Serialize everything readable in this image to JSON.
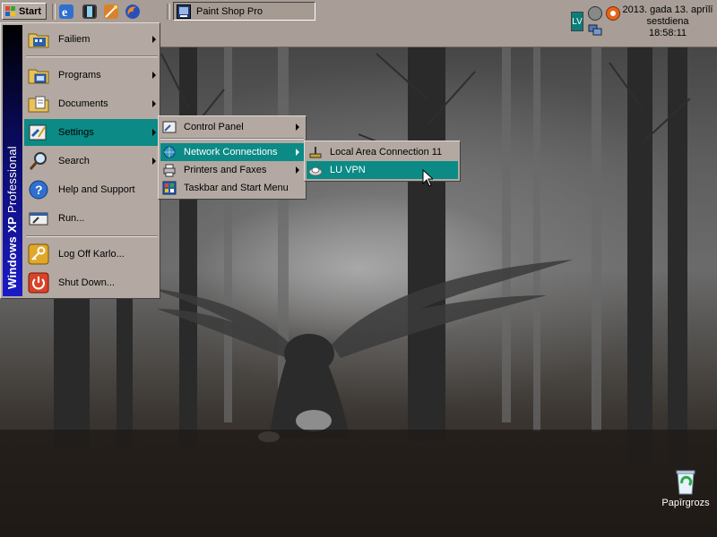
{
  "taskbar": {
    "start_label": "Start",
    "quick_launch": [
      "ie-icon",
      "media-icon",
      "wand-icon",
      "firefox-icon"
    ],
    "tasks": [
      {
        "label": "Paint Shop Pro",
        "icon": "paint-shop-pro-icon"
      }
    ],
    "tray": {
      "language": "LV",
      "clock_date": "2013. gada 13. aprīlī",
      "clock_day": "sestdiena",
      "clock_time": "18:58:11"
    }
  },
  "start_menu": {
    "banner_bold": "Windows XP",
    "banner_light": " Professional",
    "items": [
      {
        "label": "Failiem",
        "icon": "folder-icon",
        "submenu": true
      },
      {
        "label": "Programs",
        "icon": "programs-icon",
        "submenu": true
      },
      {
        "label": "Documents",
        "icon": "documents-icon",
        "submenu": true
      },
      {
        "label": "Settings",
        "icon": "settings-icon",
        "submenu": true
      },
      {
        "label": "Search",
        "icon": "search-icon",
        "submenu": true
      },
      {
        "label": "Help and Support",
        "icon": "help-icon",
        "submenu": false
      },
      {
        "label": "Run...",
        "icon": "run-icon",
        "submenu": false
      },
      {
        "label": "Log Off Karlo...",
        "icon": "key-icon",
        "submenu": false
      },
      {
        "label": "Shut Down...",
        "icon": "power-icon",
        "submenu": false
      }
    ]
  },
  "settings_menu": {
    "items": [
      {
        "label": "Control Panel",
        "icon": "control-panel-icon",
        "submenu": true
      },
      {
        "label": "Network Connections",
        "icon": "network-icon",
        "submenu": true
      },
      {
        "label": "Printers and Faxes",
        "icon": "printer-icon",
        "submenu": true
      },
      {
        "label": "Taskbar and Start Menu",
        "icon": "taskbar-icon",
        "submenu": false
      }
    ]
  },
  "network_menu": {
    "items": [
      {
        "label": "Local Area Connection 11",
        "icon": "lan-icon"
      },
      {
        "label": "LU VPN",
        "icon": "vpn-icon"
      }
    ]
  },
  "desktop": {
    "icons": [
      {
        "label": "Papīrgrozs",
        "icon": "recycle-bin-icon"
      }
    ]
  },
  "colors": {
    "highlight": "#0b8a86",
    "menu_bg": "#b3a9a2",
    "taskbar_bg": "#a89e97"
  }
}
